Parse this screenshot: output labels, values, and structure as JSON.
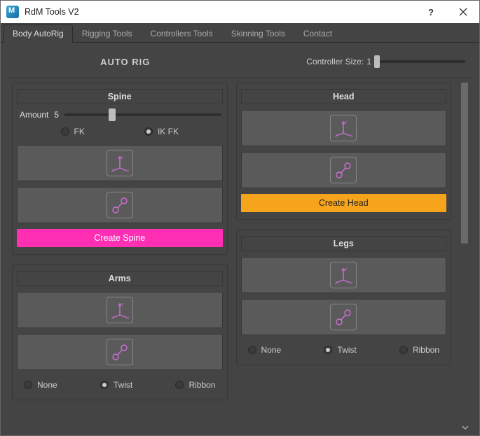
{
  "window": {
    "title": "RdM Tools V2"
  },
  "tabs": [
    {
      "label": "Body AutoRig",
      "active": true
    },
    {
      "label": "Rigging Tools",
      "active": false
    },
    {
      "label": "Controllers Tools",
      "active": false
    },
    {
      "label": "Skinning Tools",
      "active": false
    },
    {
      "label": "Contact",
      "active": false
    }
  ],
  "header": {
    "autorig_label": "AUTO RIG",
    "ctrlsize_label": "Controller Size:",
    "ctrlsize_value": "1"
  },
  "spine": {
    "title": "Spine",
    "amount_label": "Amount",
    "amount_value": "5",
    "radios": {
      "fk": "FK",
      "ikfk": "IK FK"
    },
    "create": "Create Spine"
  },
  "arms": {
    "title": "Arms",
    "radios": {
      "none": "None",
      "twist": "Twist",
      "ribbon": "Ribbon"
    }
  },
  "head": {
    "title": "Head",
    "create": "Create Head"
  },
  "legs": {
    "title": "Legs",
    "radios": {
      "none": "None",
      "twist": "Twist",
      "ribbon": "Ribbon"
    }
  },
  "colors": {
    "magenta": "#ff2fb3",
    "orange": "#f7a41d",
    "icon": "#cc6fd4"
  }
}
